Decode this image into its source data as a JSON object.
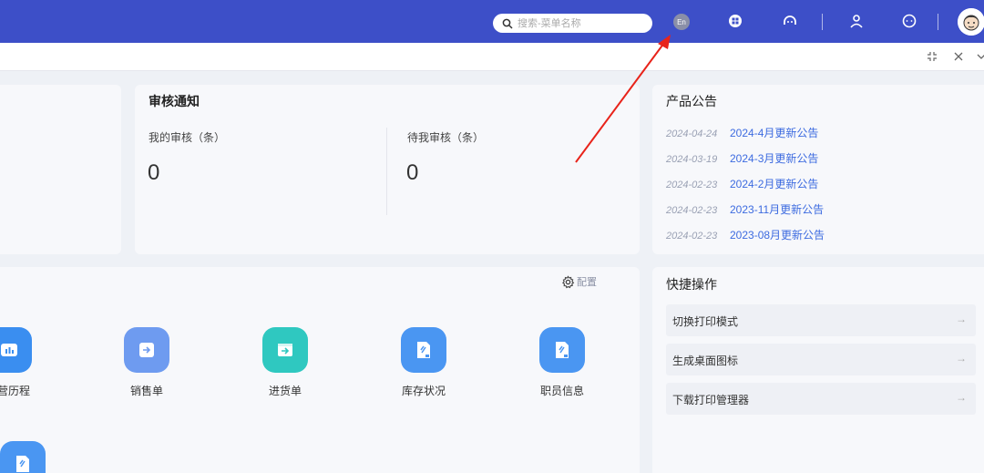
{
  "header": {
    "search_placeholder": "搜索-菜单名称",
    "lang_badge": "En"
  },
  "audit": {
    "title": "审核通知",
    "my_label": "我的审核（条）",
    "my_value": "0",
    "pending_label": "待我审核（条）",
    "pending_value": "0"
  },
  "announcements": {
    "title": "产品公告",
    "items": [
      {
        "date": "2024-04-24",
        "text": "2024-4月更新公告"
      },
      {
        "date": "2024-03-19",
        "text": "2024-3月更新公告"
      },
      {
        "date": "2024-02-23",
        "text": "2024-2月更新公告"
      },
      {
        "date": "2024-02-23",
        "text": "2023-11月更新公告"
      },
      {
        "date": "2024-02-23",
        "text": "2023-08月更新公告"
      }
    ]
  },
  "shortcuts": {
    "config_label": "配置",
    "items": [
      {
        "label": "营历程",
        "color": "#3a8ef0",
        "icon": "chart-icon"
      },
      {
        "label": "销售单",
        "color": "#6e9bf0",
        "icon": "sales-order-icon"
      },
      {
        "label": "进货单",
        "color": "#2fc8c0",
        "icon": "purchase-order-icon"
      },
      {
        "label": "库存状况",
        "color": "#4a96f2",
        "icon": "inventory-icon"
      },
      {
        "label": "职员信息",
        "color": "#4a96f2",
        "icon": "staff-info-icon"
      }
    ]
  },
  "quick_ops": {
    "title": "快捷操作",
    "items": [
      {
        "label": "切换打印模式"
      },
      {
        "label": "生成桌面图标"
      },
      {
        "label": "下载打印管理器"
      }
    ]
  },
  "colors": {
    "header_bg": "#3d4fc8",
    "link": "#3d6be0",
    "annotation_arrow": "#e8231a"
  }
}
